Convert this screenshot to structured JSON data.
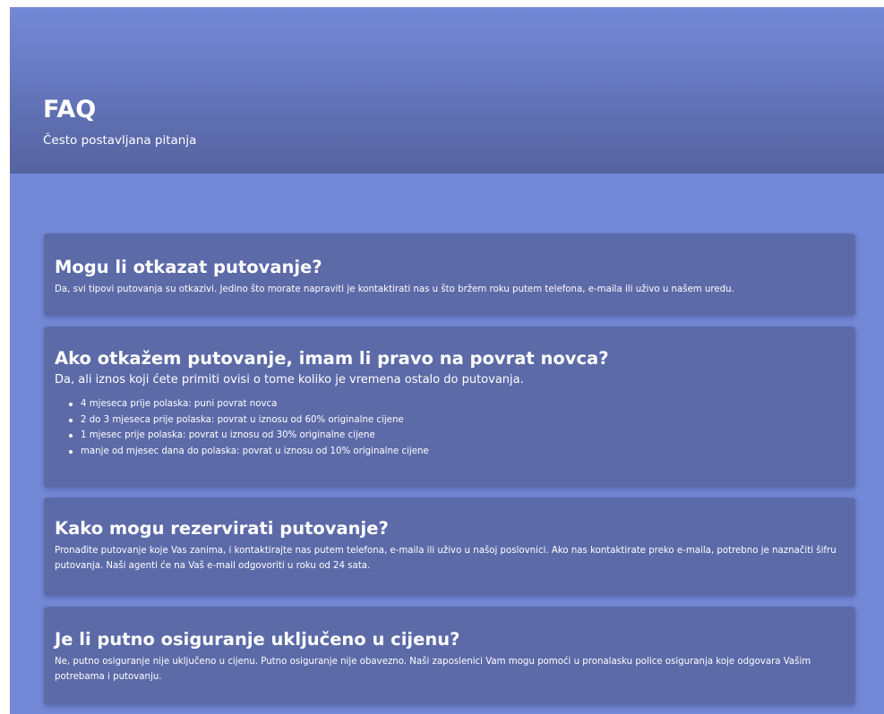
{
  "header": {
    "title": "FAQ",
    "subtitle": "Često postavljana pitanja"
  },
  "faqs": [
    {
      "question": "Mogu li otkazat putovanje?",
      "answer": "Da, svi tipovi putovanja su otkazivi. Jedino što morate napraviti je kontaktirati nas u što bržem roku putem telefona, e-maila ili uživo u našem uredu."
    },
    {
      "question": "Ako otkažem putovanje, imam li pravo na povrat novca?",
      "answer": "Da, ali iznos koji ćete primiti ovisi o tome koliko je vremena ostalo do putovanja.",
      "items": [
        "4 mjeseca prije polaska: puni povrat novca",
        "2 do 3 mjeseca prije polaska: povrat u iznosu od 60% originalne cijene",
        "1 mjesec prije polaska: povrat u iznosu od 30% originalne cijene",
        "manje od mjesec dana do polaska: povrat u iznosu od 10% originalne cijene"
      ]
    },
    {
      "question": "Kako mogu rezervirati putovanje?",
      "answer": "Pronađite putovanje koje Vas zanima, i kontaktirajte nas putem telefona, e-maila ili uživo u našoj poslovnici. Ako nas kontaktirate preko e-maila, potrebno je naznačiti šifru putovanja. Naši agenti će na Vaš e-mail odgovoriti u roku od 24 sata."
    },
    {
      "question": "Je li putno osiguranje uključeno u cijenu?",
      "answer": "Ne, putno osiguranje nije uključeno u cijenu. Putno osiguranje nije obavezno. Naši zaposlenici Vam mogu pomoći u pronalasku police osiguranja koje odgovara Vašim potrebama i putovanju."
    }
  ]
}
